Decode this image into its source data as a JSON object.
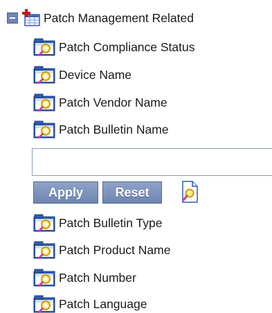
{
  "tree": {
    "root": {
      "label": "Patch Management Related",
      "collapse_symbol": "minus",
      "icon": "report-table-icon"
    },
    "items_before": [
      {
        "label": "Patch Compliance Status",
        "icon": "folder-search-icon"
      },
      {
        "label": "Device Name",
        "icon": "folder-search-icon"
      },
      {
        "label": "Patch Vendor Name",
        "icon": "folder-search-icon"
      },
      {
        "label": "Patch Bulletin Name",
        "icon": "folder-search-icon"
      }
    ],
    "filter": {
      "value": "",
      "placeholder": ""
    },
    "buttons": {
      "apply": "Apply",
      "reset": "Reset"
    },
    "items_after": [
      {
        "label": "Patch Bulletin Type",
        "icon": "folder-search-icon"
      },
      {
        "label": "Patch Product Name",
        "icon": "folder-search-icon"
      },
      {
        "label": "Patch Number",
        "icon": "folder-search-icon"
      },
      {
        "label": "Patch Language",
        "icon": "folder-search-icon"
      }
    ]
  },
  "colors": {
    "button": "#7b90b9",
    "accent_red": "#cc1111",
    "folder_blue": "#3a63b4"
  }
}
